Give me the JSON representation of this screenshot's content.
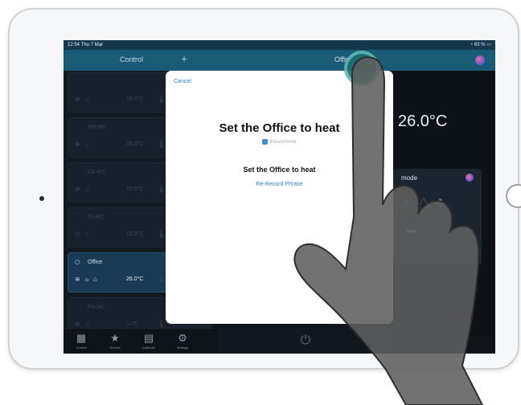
{
  "status_bar": {
    "time": "12:54",
    "date": "Thu 7 Mar",
    "battery": "63 %"
  },
  "nav": {
    "left_title": "Control",
    "plus_label": "+",
    "right_title": "Office"
  },
  "ac_list": [
    {
      "name": "",
      "temp": "24.0°C",
      "selected": false
    },
    {
      "name": "MH-RC",
      "temp": "26.0°C",
      "selected": false
    },
    {
      "name": "CK-RC",
      "temp": "25.0°C",
      "selected": false
    },
    {
      "name": "FJ-RC",
      "temp": "22.0°C",
      "selected": false
    },
    {
      "name": "Office",
      "temp": "26.0°C",
      "selected": true
    },
    {
      "name": "FH-AC",
      "temp": "—°C",
      "selected": false
    }
  ],
  "right_panel": {
    "temperature": "26.0°C",
    "mode_label": "mode",
    "heat_label": "heat"
  },
  "tabs": [
    {
      "label": "Control",
      "icon": "grid-icon"
    },
    {
      "label": "Scenes",
      "icon": "star-icon"
    },
    {
      "label": "Calendar",
      "icon": "calendar-icon"
    },
    {
      "label": "Settings",
      "icon": "gear-icon"
    }
  ],
  "modal": {
    "cancel": "Cancel",
    "phrase": "Set the Office  to heat",
    "app_name": "IntesisHome",
    "phrase_small": "Set the Office to heat",
    "rerecord": "Re-Record Phrase"
  },
  "colors": {
    "nav": "#1a5b78",
    "accent": "#2f7ee0",
    "touch": "#1a6d72"
  }
}
